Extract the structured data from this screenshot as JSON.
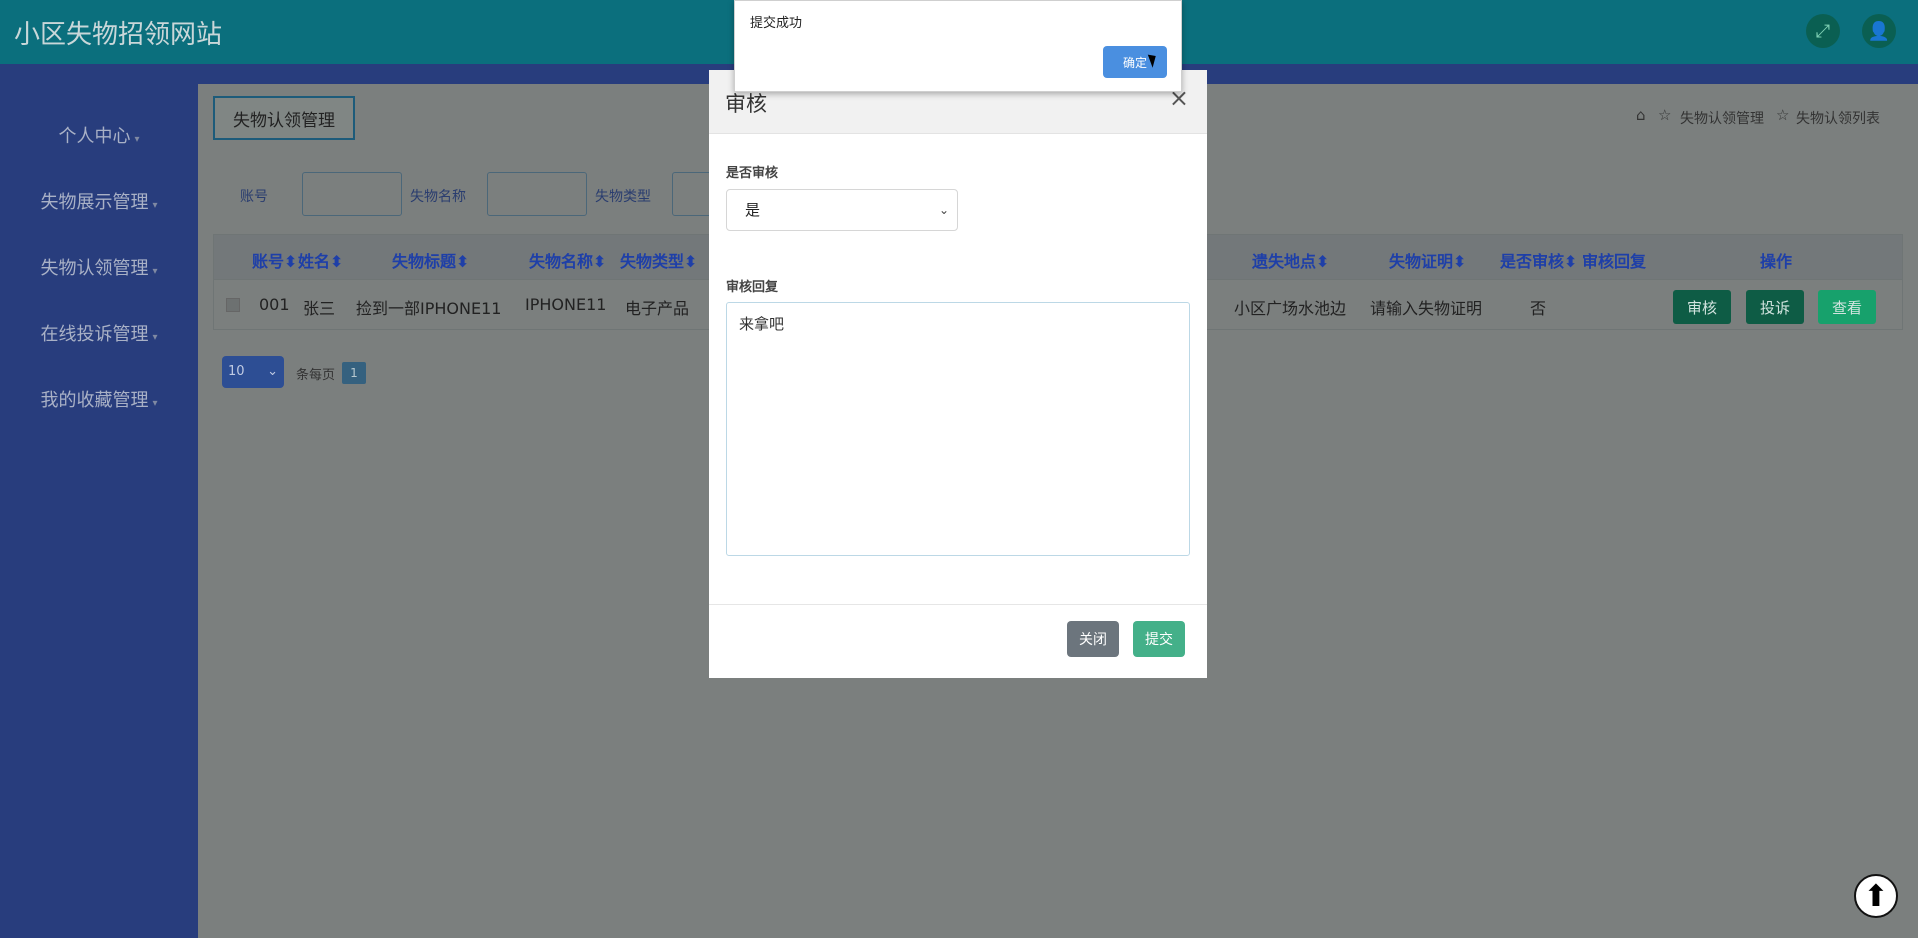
{
  "app": {
    "title": "小区失物招领网站"
  },
  "header": {
    "fullscreen_icon": "fullscreen-icon",
    "user_icon": "user-icon"
  },
  "sidebar": {
    "items": [
      {
        "label": "个人中心"
      },
      {
        "label": "失物展示管理"
      },
      {
        "label": "失物认领管理"
      },
      {
        "label": "在线投诉管理"
      },
      {
        "label": "我的收藏管理"
      }
    ]
  },
  "page": {
    "title": "失物认领管理",
    "breadcrumb": [
      "失物认领管理",
      "失物认领列表"
    ]
  },
  "filters": {
    "account_label": "账号",
    "item_name_label": "失物名称",
    "item_type_label": "失物类型"
  },
  "table": {
    "headers": [
      "账号",
      "姓名",
      "失物标题",
      "失物名称",
      "失物类型",
      "遗失地点",
      "失物证明",
      "是否审核",
      "审核回复",
      "操作"
    ],
    "rows": [
      {
        "account": "001",
        "name": "张三",
        "title": "捡到一部IPHONE11",
        "item_name": "IPHONE11",
        "item_type": "电子产品",
        "location": "小区广场水池边",
        "proof": "请输入失物证明",
        "reviewed": "否",
        "reply": ""
      }
    ],
    "actions": [
      "审核",
      "投诉",
      "查看"
    ]
  },
  "pagination": {
    "page_size": "10",
    "page_size_label": "条每页",
    "current_page": "1"
  },
  "modal": {
    "title": "审核",
    "review_label": "是否审核",
    "review_value": "是",
    "reply_label": "审核回复",
    "reply_value": "来拿吧",
    "close_label": "关闭",
    "submit_label": "提交"
  },
  "alert": {
    "message": "提交成功",
    "confirm_label": "确定"
  },
  "colors": {
    "topbar": "#0b6f7d",
    "sidebar": "#283d7d",
    "audit_button": "#0e5c45",
    "complain_button": "#0e5c45",
    "view_button": "#17a16c",
    "submit_button": "#44b089",
    "close_button": "#6c757d",
    "confirm_button": "#4a8fe0"
  }
}
